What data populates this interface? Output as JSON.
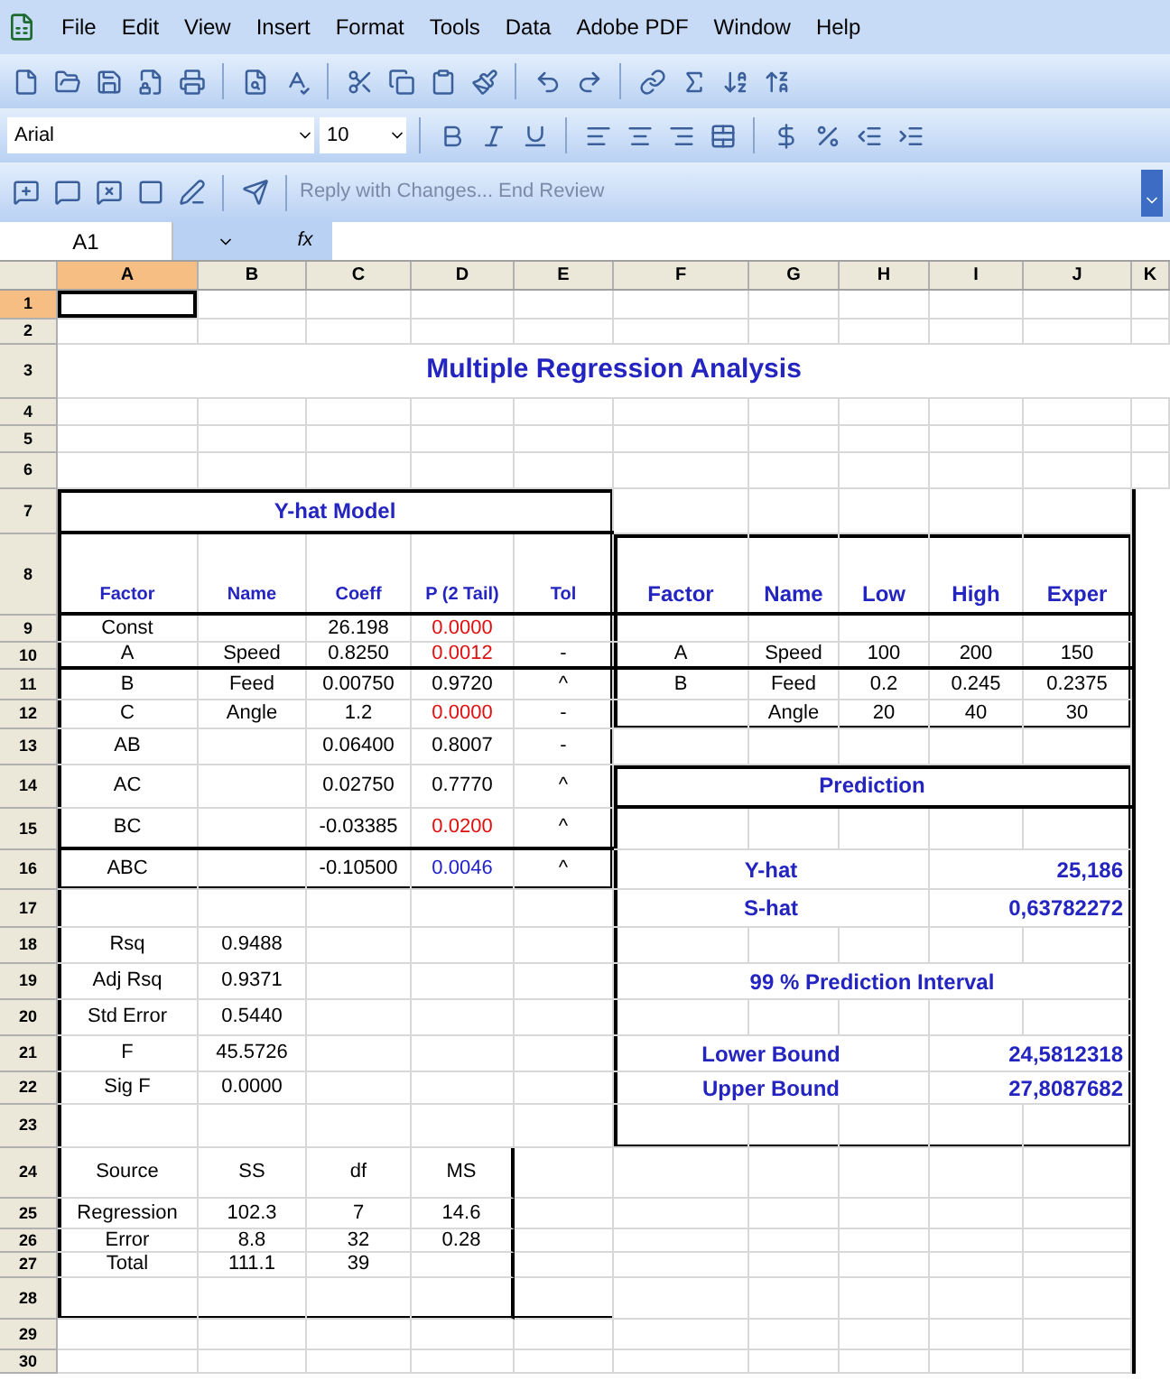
{
  "menu": [
    "File",
    "Edit",
    "View",
    "Insert",
    "Format",
    "Tools",
    "Data",
    "Adobe PDF",
    "Window",
    "Help"
  ],
  "formatting": {
    "font": "Arial",
    "size": "10"
  },
  "review_toolbar": {
    "text": "Reply with Changes... End Review"
  },
  "formula_bar": {
    "name_box": "A1",
    "fx": "fx"
  },
  "columns": [
    {
      "label": "A",
      "selected": true
    },
    {
      "label": "B",
      "selected": false
    },
    {
      "label": "C",
      "selected": false
    },
    {
      "label": "D",
      "selected": false
    },
    {
      "label": "E",
      "selected": false
    },
    {
      "label": "F",
      "selected": false
    },
    {
      "label": "G",
      "selected": false
    },
    {
      "label": "H",
      "selected": false
    },
    {
      "label": "I",
      "selected": false
    },
    {
      "label": "J",
      "selected": false
    },
    {
      "label": "K",
      "selected": false
    }
  ],
  "rows": [
    "1",
    "2",
    "3",
    "4",
    "5",
    "6",
    "7",
    "8",
    "9",
    "10",
    "11",
    "12",
    "13",
    "14",
    "15",
    "16",
    "17",
    "18",
    "19",
    "20",
    "21",
    "22",
    "23",
    "24",
    "25",
    "26",
    "27",
    "28",
    "29",
    "30"
  ],
  "title": "Multiple Regression Analysis",
  "model": {
    "title": "Y-hat Model",
    "headers": [
      "Factor",
      "Name",
      "Coeff",
      "P (2 Tail)",
      "Tol"
    ],
    "rows": [
      {
        "factor": "Const",
        "coeff": "26.198",
        "p": "0.0000",
        "color": "#e01010"
      },
      {
        "factor": "A",
        "name": "Speed",
        "coeff": "0.8250",
        "p": "0.0012",
        "color": "#e01010",
        "flag": "-"
      },
      {
        "factor": "B",
        "name": "Feed",
        "coeff": "0.00750",
        "p": "0.9720",
        "color": "#000000",
        "flag": "^"
      },
      {
        "factor": "C",
        "name": "Angle",
        "coeff": "1.2",
        "p": "0.0000",
        "color": "#e01010",
        "flag": "-"
      },
      {
        "factor": "AB",
        "coeff": "0.06400",
        "p": "0.8007",
        "color": "#000000",
        "flag": "-"
      },
      {
        "factor": "AC",
        "coeff": "0.02750",
        "p": "0.7770",
        "color": "#000000",
        "flag": "^"
      },
      {
        "factor": "BC",
        "coeff": "-0.03385",
        "p": "0.0200",
        "color": "#e01010",
        "flag": "^"
      },
      {
        "factor": "ABC",
        "coeff": "-0.10500",
        "p": "0.0046",
        "color": "#2222cc",
        "flag": "^"
      }
    ]
  },
  "stats": [
    {
      "label": "Rsq",
      "value": "0.9488"
    },
    {
      "label": "Adj Rsq",
      "value": "0.9371"
    },
    {
      "label": "Std Error",
      "value": "0.5440"
    },
    {
      "label": "F",
      "value": "45.5726"
    },
    {
      "label": "Sig F",
      "value": "0.0000"
    }
  ],
  "anova": {
    "headers": [
      "Source",
      "SS",
      "df",
      "MS"
    ],
    "rows": [
      [
        "Regression",
        "102.3",
        "7",
        "14.6"
      ],
      [
        "Error",
        "8.8",
        "32",
        "0.28"
      ],
      [
        "Total",
        "111.1",
        "39"
      ]
    ]
  },
  "factors": {
    "headers": [
      "Factor",
      "Name",
      "Low",
      "High",
      "Exper"
    ],
    "rows": [
      [
        "A",
        "Speed",
        "100",
        "200",
        "150"
      ],
      [
        "B",
        "Feed",
        "0.2",
        "0.245",
        "0.2375"
      ],
      [
        "",
        "Angle",
        "20",
        "40",
        "30"
      ]
    ]
  },
  "prediction": {
    "title": "Prediction",
    "yhat": {
      "label": "Y-hat",
      "value": "25,186"
    },
    "shat": {
      "label": "S-hat",
      "value": "0,63782272"
    },
    "interval": "99 % Prediction Interval",
    "lower": {
      "label": "Lower Bound",
      "value": "24,5812318"
    },
    "upper": {
      "label": "Upper Bound",
      "value": "27,8087682"
    }
  }
}
